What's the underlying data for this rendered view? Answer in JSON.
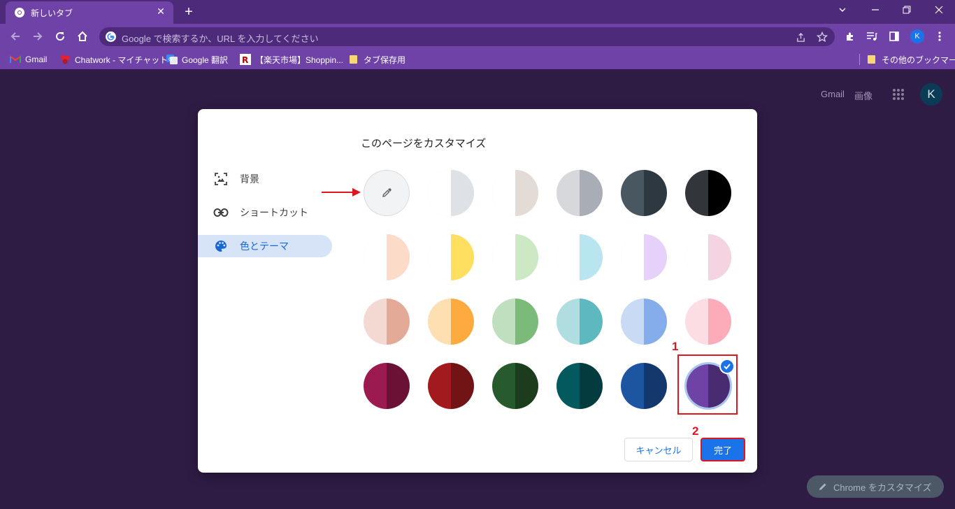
{
  "tab": {
    "title": "新しいタブ"
  },
  "omnibox": {
    "placeholder": "Google で検索するか、URL を入力してください"
  },
  "profile_initial": "K",
  "bookmarks": [
    {
      "label": "Gmail",
      "icon": "gmail-icon"
    },
    {
      "label": "Chatwork - マイチャット",
      "icon": "chatwork-icon"
    },
    {
      "label": "Google 翻訳",
      "icon": "google-translate-icon"
    },
    {
      "label": "【楽天市場】Shoppin...",
      "icon": "rakuten-icon"
    },
    {
      "label": "タブ保存用",
      "icon": "folder-icon"
    }
  ],
  "other_bookmarks": "その他のブックマーク",
  "ntp": {
    "gmail": "Gmail",
    "images": "画像",
    "avatar": "K",
    "customize_chrome": "Chrome をカスタマイズ"
  },
  "dialog": {
    "title": "このページをカスタマイズ",
    "menu": [
      {
        "label": "背景",
        "icon": "image-icon",
        "selected": false
      },
      {
        "label": "ショートカット",
        "icon": "link-icon",
        "selected": false
      },
      {
        "label": "色とテーマ",
        "icon": "palette-icon",
        "selected": true
      }
    ],
    "color_rows": [
      [
        [
          "#f1f3f4",
          "#f1f3f4"
        ],
        [
          "#ffffff",
          "#dee1e6"
        ],
        [
          "#ffffff",
          "#e3dcd6"
        ],
        [
          "#d7d8dc",
          "#a9adb6"
        ],
        [
          "#485760",
          "#2e3840"
        ],
        [
          "#32353a",
          "#000000"
        ]
      ],
      [
        [
          "#ffffff",
          "#fddbc9"
        ],
        [
          "#ffffff",
          "#fedf60"
        ],
        [
          "#ffffff",
          "#cde9c3"
        ],
        [
          "#ffffff",
          "#b9e5f0"
        ],
        [
          "#ffffff",
          "#e6d1fa"
        ],
        [
          "#ffffff",
          "#f5d3e1"
        ]
      ],
      [
        [
          "#f4d9d3",
          "#e3aa97"
        ],
        [
          "#fddfb2",
          "#fdab3f"
        ],
        [
          "#bfdfbf",
          "#7bbb7a"
        ],
        [
          "#b0dde0",
          "#5db9bf"
        ],
        [
          "#c9dbf4",
          "#85adeb"
        ],
        [
          "#fddde4",
          "#fcacb9"
        ]
      ],
      [
        [
          "#9b1a4f",
          "#6b1136"
        ],
        [
          "#a11b1e",
          "#721315"
        ],
        [
          "#275a2c",
          "#1b3d1e"
        ],
        [
          "#04595f",
          "#033b3f"
        ],
        [
          "#1d55a0",
          "#13386c"
        ],
        [
          "#6f42a5",
          "#482b70"
        ]
      ]
    ],
    "selected_color": "purple",
    "cancel": "キャンセル",
    "done": "完了"
  },
  "annotations": {
    "step1": "1",
    "step2": "2"
  }
}
